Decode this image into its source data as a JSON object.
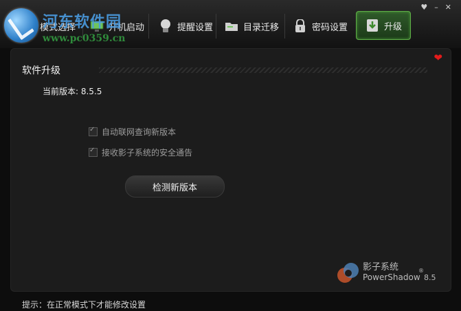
{
  "window": {
    "controls": [
      "menu",
      "minimize",
      "close"
    ]
  },
  "watermark": {
    "title": "河东软件园",
    "url": "www.pc0359.cn"
  },
  "tabs": [
    {
      "label": "模式选择",
      "icon": "mode-icon"
    },
    {
      "label": "开机启动",
      "icon": "monitor-icon"
    },
    {
      "label": "提醒设置",
      "icon": "bulb-icon"
    },
    {
      "label": "目录迁移",
      "icon": "folder-icon"
    },
    {
      "label": "密码设置",
      "icon": "lock-icon"
    },
    {
      "label": "升级",
      "icon": "upgrade-icon",
      "active": true
    }
  ],
  "panel": {
    "title": "软件升级",
    "current_version_label": "当前版本: 8.5.5",
    "options": [
      {
        "label": "自动联网查询新版本",
        "checked": true,
        "disabled": true
      },
      {
        "label": "接收影子系统的安全通告",
        "checked": true,
        "disabled": true
      }
    ],
    "check_button": "检测新版本"
  },
  "brand": {
    "name_cn": "影子系统",
    "name_en": "PowerShadow",
    "reg": "®",
    "version": "8.5"
  },
  "hint": "提示：在正常模式下才能修改设置",
  "colors": {
    "accent": "#5fae47",
    "heart": "#e31b1b",
    "background": "#0d0d0d",
    "panel": "#1c1c1c"
  }
}
